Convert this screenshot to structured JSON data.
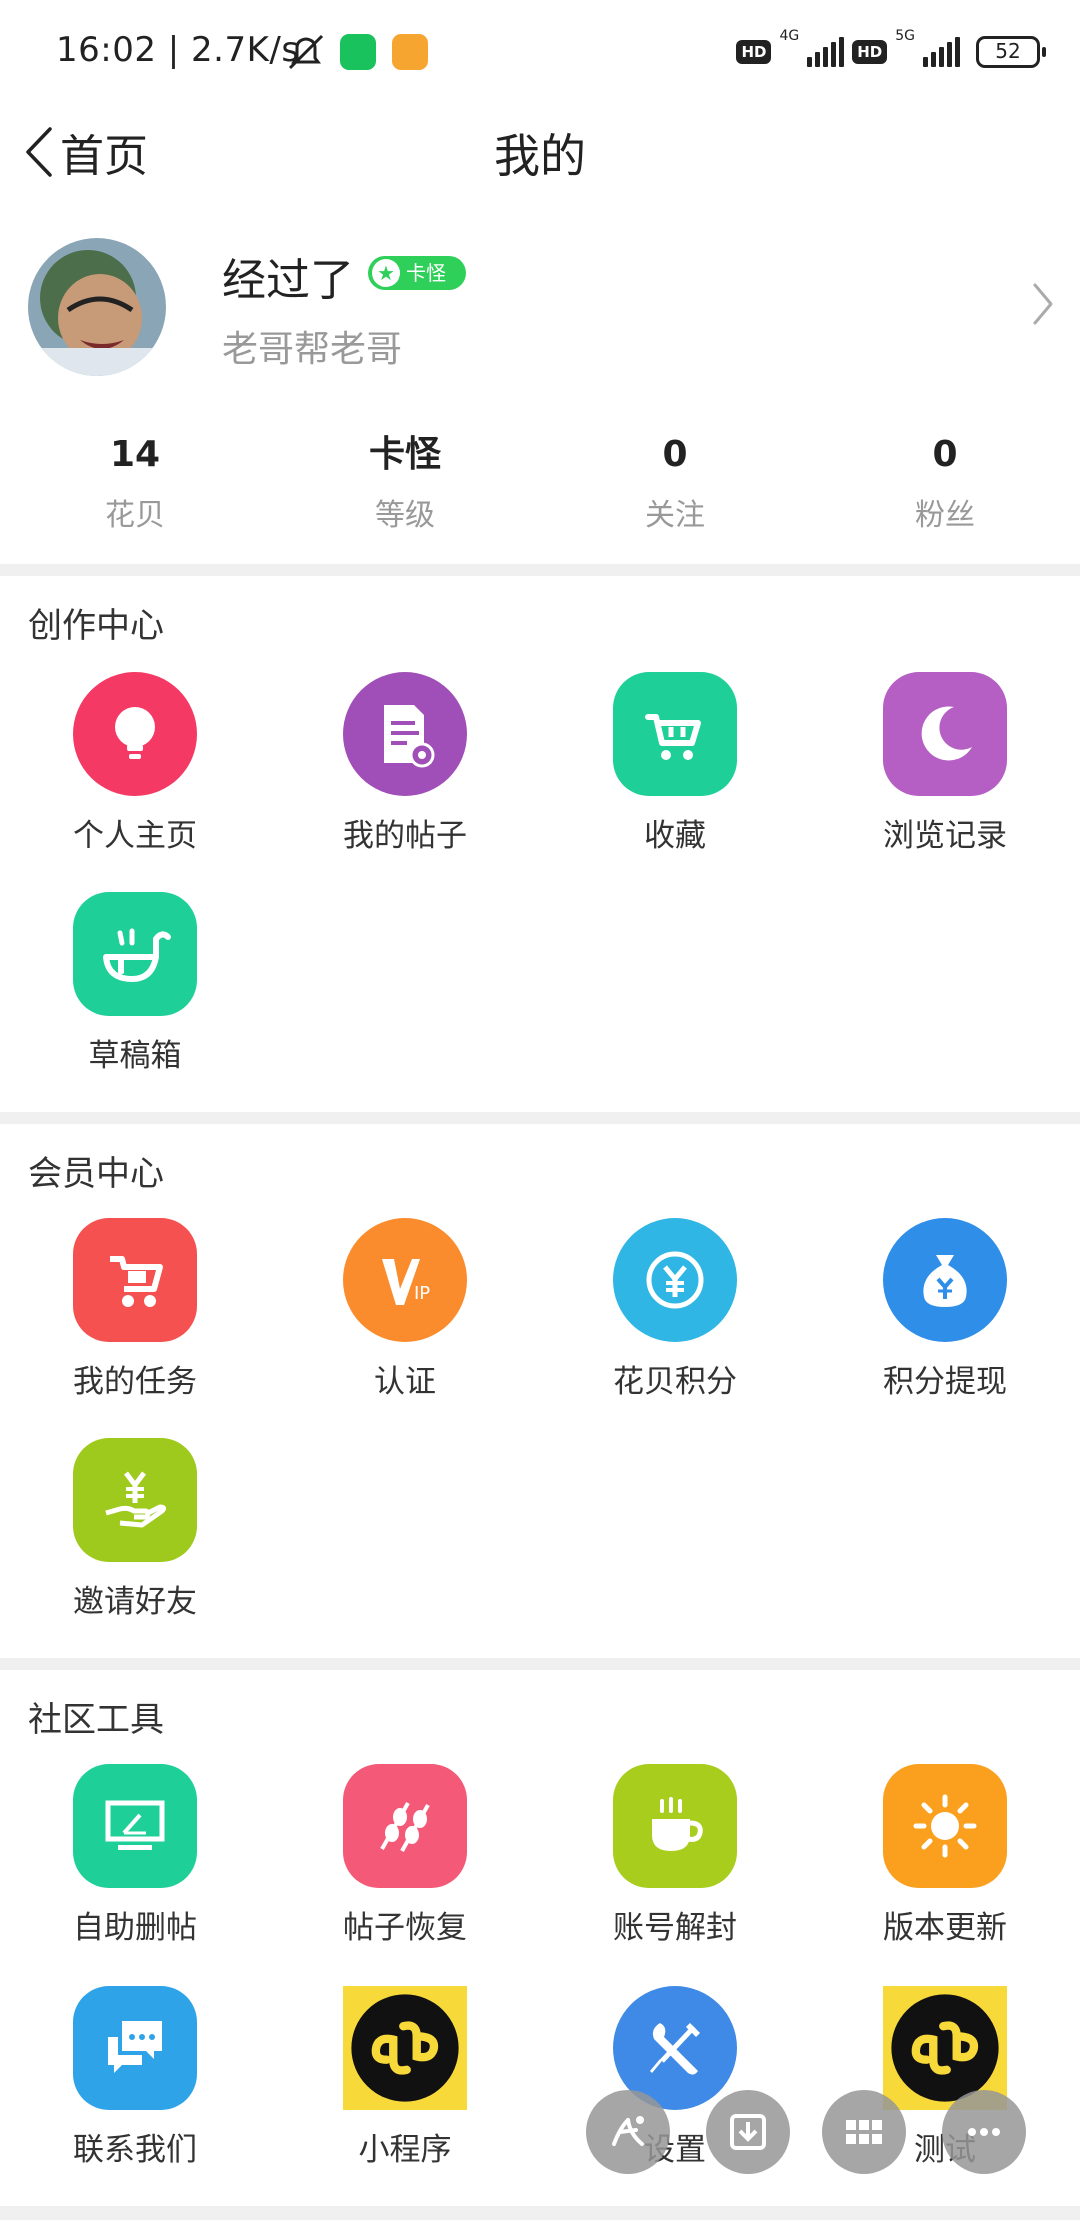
{
  "status_bar": {
    "time": "16:02 | 2.7K/s",
    "hd1": "HD",
    "net1": "4G",
    "hd2": "HD",
    "net2": "5G",
    "battery": "52"
  },
  "header": {
    "back_label": "首页",
    "title": "我的"
  },
  "profile": {
    "name": "经过了",
    "badge": "卡怪",
    "signature": "老哥帮老哥"
  },
  "stats": [
    {
      "value": "14",
      "label": "花贝"
    },
    {
      "value": "卡怪",
      "label": "等级"
    },
    {
      "value": "0",
      "label": "关注"
    },
    {
      "value": "0",
      "label": "粉丝"
    }
  ],
  "sections": {
    "creation": {
      "title": "创作中心",
      "items": [
        {
          "label": "个人主页",
          "icon": "lightbulb-icon",
          "color": "#f43a64"
        },
        {
          "label": "我的帖子",
          "icon": "document-icon",
          "color": "#a04fb8"
        },
        {
          "label": "收藏",
          "icon": "cart-icon",
          "color": "#1fcf98"
        },
        {
          "label": "浏览记录",
          "icon": "moon-icon",
          "color": "#b55ec4"
        },
        {
          "label": "草稿箱",
          "icon": "draft-icon",
          "color": "#1fcf98"
        }
      ]
    },
    "member": {
      "title": "会员中心",
      "items": [
        {
          "label": "我的任务",
          "icon": "task-icon",
          "color": "#f45150"
        },
        {
          "label": "认证",
          "icon": "vip-icon",
          "color": "#fb8c2d"
        },
        {
          "label": "花贝积分",
          "icon": "yen-coin-icon",
          "color": "#2fb6e4"
        },
        {
          "label": "积分提现",
          "icon": "money-bag-icon",
          "color": "#2f8ee8"
        },
        {
          "label": "邀请好友",
          "icon": "yen-hand-icon",
          "color": "#9ec91d"
        }
      ]
    },
    "tools": {
      "title": "社区工具",
      "items": [
        {
          "label": "自助删帖",
          "icon": "monitor-icon",
          "color": "#1fcf98"
        },
        {
          "label": "帖子恢复",
          "icon": "skewer-icon",
          "color": "#f45a78"
        },
        {
          "label": "账号解封",
          "icon": "cup-icon",
          "color": "#a8cd1c"
        },
        {
          "label": "版本更新",
          "icon": "sun-icon",
          "color": "#fba01e"
        },
        {
          "label": "联系我们",
          "icon": "chat-icon",
          "color": "#2fa3e8"
        },
        {
          "label": "小程序",
          "icon": "mini-program-icon",
          "color": "#f8d93a"
        },
        {
          "label": "设置",
          "icon": "wrench-icon",
          "color": "#3f8ae6"
        },
        {
          "label": "测试",
          "icon": "mini-program-icon",
          "color": "#f8d93a"
        }
      ]
    }
  }
}
